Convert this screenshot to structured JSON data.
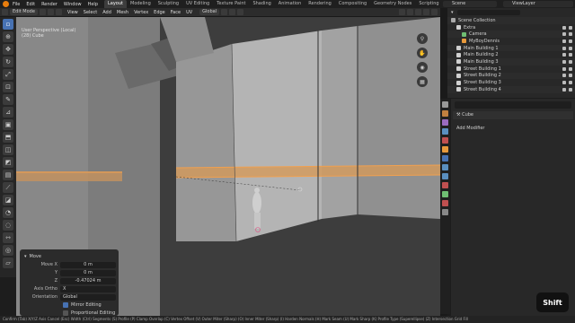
{
  "app": {
    "menus": [
      "File",
      "Edit",
      "Render",
      "Window",
      "Help"
    ],
    "workspaces": [
      "Layout",
      "Modeling",
      "Sculpting",
      "UV Editing",
      "Texture Paint",
      "Shading",
      "Animation",
      "Rendering",
      "Compositing",
      "Geometry Nodes",
      "Scripting"
    ],
    "active_workspace": "Layout",
    "scene": "Scene",
    "view_layer": "ViewLayer"
  },
  "header": {
    "mode": "Edit Mode",
    "menus": [
      "View",
      "Select",
      "Add",
      "Mesh",
      "Vertex",
      "Edge",
      "Face",
      "UV"
    ],
    "transform_orientation": "Global"
  },
  "viewport": {
    "view_name": "User Perspective (Local)",
    "object_name": "(28) Cube"
  },
  "operator_panel": {
    "title": "Move",
    "fields": [
      {
        "label": "Move X",
        "value": "0 m"
      },
      {
        "label": "Y",
        "value": "0 m"
      },
      {
        "label": "Z",
        "value": "-0.47024 m"
      }
    ],
    "axis_ortho_label": "Axis Ortho",
    "axis_ortho_value": "X",
    "orientation_label": "Orientation",
    "orientation_value": "Global",
    "mirror_editing": "Mirror Editing",
    "proportional_editing": "Proportional Editing"
  },
  "outliner": {
    "title": "Scene Collection",
    "items": [
      {
        "label": "Extra",
        "color": "#d0d0d0"
      },
      {
        "label": "Camera",
        "color": "#6fbf73"
      },
      {
        "label": "MyBoyDennis",
        "color": "#e89a3c"
      },
      {
        "label": "Main Building 1",
        "color": "#d0d0d0"
      },
      {
        "label": "Main Building 2",
        "color": "#d0d0d0"
      },
      {
        "label": "Main Building 3",
        "color": "#d0d0d0"
      },
      {
        "label": "Street Building 1",
        "color": "#d0d0d0"
      },
      {
        "label": "Street Building 2",
        "color": "#d0d0d0"
      },
      {
        "label": "Street Building 3",
        "color": "#d0d0d0"
      },
      {
        "label": "Street Building 4",
        "color": "#d0d0d0"
      }
    ]
  },
  "properties": {
    "object_name": "Cube",
    "add_modifier": "Add Modifier"
  },
  "key_overlay": "Shift",
  "status_bar": "Confirm (Tab)  X/Y/Z Axis  Cancel (Esc)  Width (Ctrl)  Segments (S)  Profile (P)  Clamp Overlap (C)  Vertex Offset (V)  Outer Miter (Sharp) (O)  Inner Miter (Sharp) (I)  Harden Normals (H)  Mark Seam (U)  Mark Sharp (K)  Profile Type (Superellipse) (Z)  Intersection Grid Fill",
  "colors": {
    "accent": "#4772b3",
    "orange": "#e87d0d",
    "selected_edge": "#f0a050"
  }
}
